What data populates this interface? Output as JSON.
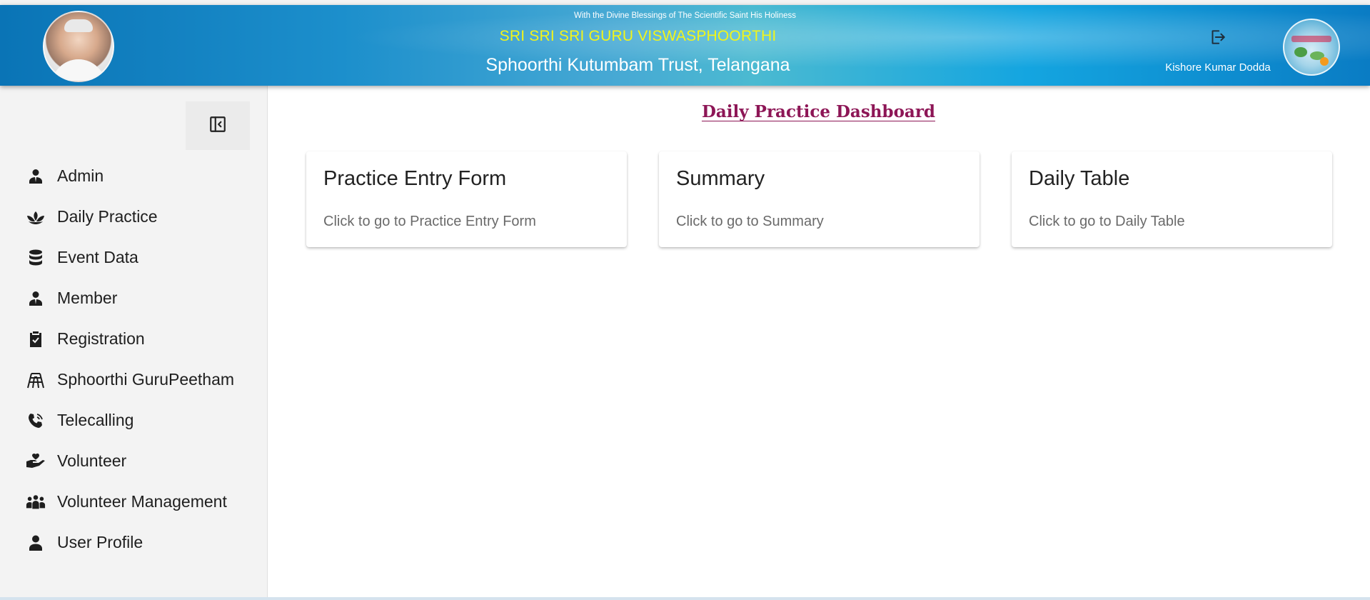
{
  "header": {
    "blessing": "With the Divine Blessings of The Scientific Saint His Holiness",
    "guru_title": "SRI SRI SRI GURU VISWASPHOORTHI",
    "trust_name": "Sphoorthi Kutumbam Trust, Telangana",
    "user_name": "Kishore Kumar Dodda",
    "logout_icon": "logout-icon",
    "colors": {
      "guru_title": "#f2f51a",
      "header_start": "#0a74b6",
      "header_end": "#0a7cc4"
    }
  },
  "sidebar": {
    "collapse_icon": "collapse-sidebar-icon",
    "items": [
      {
        "label": "Admin",
        "icon": "admin-icon"
      },
      {
        "label": "Daily Practice",
        "icon": "lotus-icon"
      },
      {
        "label": "Event Data",
        "icon": "database-icon"
      },
      {
        "label": "Member",
        "icon": "member-icon"
      },
      {
        "label": "Registration",
        "icon": "clipboard-check-icon"
      },
      {
        "label": "Sphoorthi GuruPeetham",
        "icon": "temple-icon"
      },
      {
        "label": "Telecalling",
        "icon": "phone-icon"
      },
      {
        "label": "Volunteer",
        "icon": "hand-heart-icon"
      },
      {
        "label": "Volunteer Management",
        "icon": "people-group-icon"
      },
      {
        "label": "User Profile",
        "icon": "user-icon"
      }
    ]
  },
  "main": {
    "title": "Daily Practice Dashboard",
    "title_color": "#8d1656",
    "cards": [
      {
        "title": "Practice Entry Form",
        "description": "Click to go to Practice Entry Form"
      },
      {
        "title": "Summary",
        "description": "Click to go to Summary"
      },
      {
        "title": "Daily Table",
        "description": "Click to go to Daily Table"
      }
    ]
  }
}
